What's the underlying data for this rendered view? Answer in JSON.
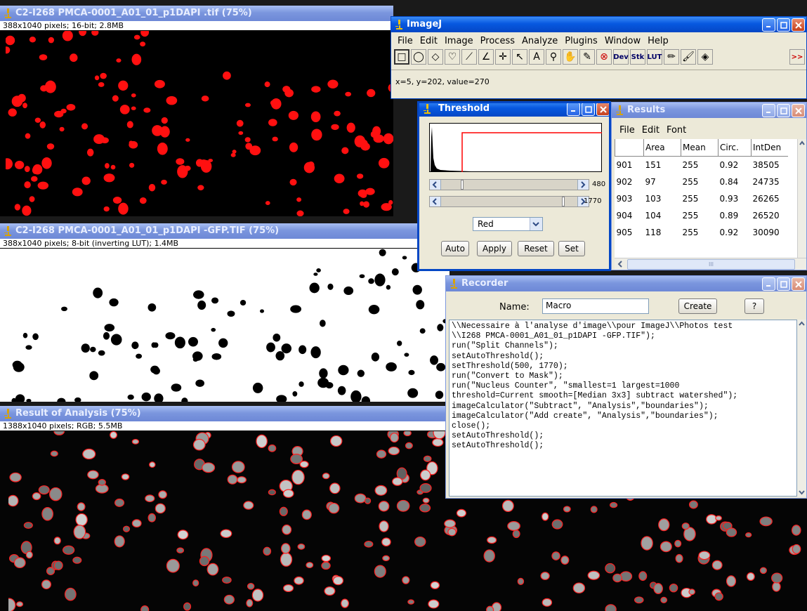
{
  "win1": {
    "title": "C2-I268 PMCA-0001_A01_01_p1DAPI .tif (75%)",
    "info": "388x1040 pixels; 16-bit; 2.8MB"
  },
  "win2": {
    "title": "C2-I268 PMCA-0001_A01_01_p1DAPI -GFP.TIF (75%)",
    "info": "388x1040 pixels; 8-bit (inverting LUT); 1.4MB"
  },
  "win3": {
    "title": "Result of Analysis (75%)",
    "info": "1388x1040 pixels; RGB; 5.5MB"
  },
  "imagej": {
    "title": "ImageJ",
    "menu": [
      "File",
      "Edit",
      "Image",
      "Process",
      "Analyze",
      "Plugins",
      "Window",
      "Help"
    ],
    "tools": [
      "rectangle-tool",
      "oval-tool",
      "polygon-tool",
      "freehand-tool",
      "line-tool",
      "angle-tool",
      "point-tool",
      "wand-tool",
      "text-tool",
      "magnifier-tool",
      "hand-tool",
      "dropper-tool",
      "stop-tool",
      "dev-tool",
      "stk-tool",
      "lut-tool",
      "pencil-tool",
      "brush-tool",
      "flood-fill-tool"
    ],
    "dev_label": "Dev",
    "stk_label": "Stk",
    "lut_label": "LUT",
    "more_label": ">>",
    "status": "x=5, y=202, value=270"
  },
  "threshold": {
    "title": "Threshold",
    "min_value": "480",
    "max_value": "1770",
    "color_mode": "Red",
    "buttons": {
      "auto": "Auto",
      "apply": "Apply",
      "reset": "Reset",
      "set": "Set"
    }
  },
  "results": {
    "title": "Results",
    "menu": [
      "File",
      "Edit",
      "Font"
    ],
    "columns": [
      "",
      "Area",
      "Mean",
      "Circ.",
      "IntDen"
    ],
    "rows": [
      [
        "901",
        "151",
        "255",
        "0.92",
        "38505"
      ],
      [
        "902",
        "97",
        "255",
        "0.84",
        "24735"
      ],
      [
        "903",
        "103",
        "255",
        "0.93",
        "26265"
      ],
      [
        "904",
        "104",
        "255",
        "0.89",
        "26520"
      ],
      [
        "905",
        "118",
        "255",
        "0.92",
        "30090"
      ]
    ],
    "scroll_label": "III"
  },
  "recorder": {
    "title": "Recorder",
    "name_label": "Name:",
    "name_value": "Macro",
    "create_label": "Create",
    "help_label": "?",
    "lines": [
      "\\\\Necessaire à l'analyse d'image\\\\pour ImageJ\\\\Photos test",
      "\\\\I268 PMCA-0001_A01_01_p1DAPI -GFP.TIF\");",
      "run(\"Split Channels\");",
      "setAutoThreshold();",
      "setThreshold(500, 1770);",
      "run(\"Convert to Mask\");",
      "run(\"Nucleus Counter\", \"smallest=1 largest=1000",
      "threshold=Current smooth=[Median 3x3] subtract watershed\");",
      "imageCalculator(\"Subtract\", \"Analysis\",\"boundaries\");",
      "imageCalculator(\"Add create\", \"Analysis\",\"boundaries\");",
      "close();",
      "setAutoThreshold();",
      "setAutoThreshold();"
    ]
  },
  "colors": {
    "titlebar_active": "#0758e0",
    "threshold_red": "#ff0000",
    "mask_red": "#ff0000"
  }
}
